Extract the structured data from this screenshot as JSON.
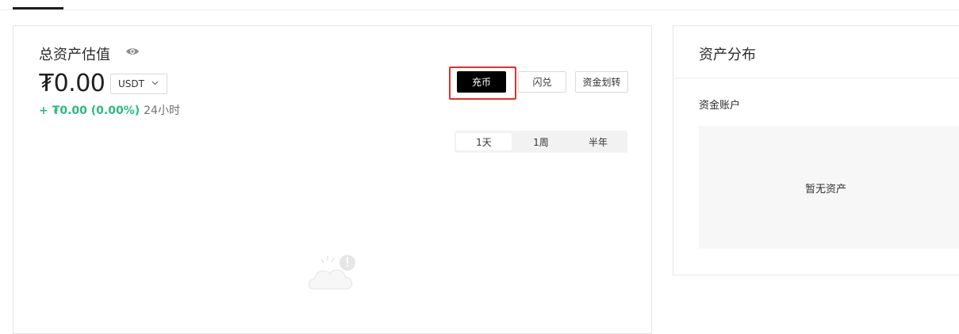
{
  "top_tabs": {
    "active_label": ""
  },
  "total_assets": {
    "title": "总资产估值",
    "balance": "₮0.00",
    "currency_select": {
      "selected": "USDT"
    },
    "change": {
      "value": "+ ₮0.00 (0.00%)",
      "period": "24小时"
    },
    "actions": {
      "deposit": "充币",
      "swap": "闪兑",
      "transfer": "资金划转"
    },
    "range_tabs": [
      {
        "label": "1天",
        "active": true
      },
      {
        "label": "1周",
        "active": false
      },
      {
        "label": "半年",
        "active": false
      }
    ],
    "icons": {
      "visibility": "eye-icon",
      "dropdown": "chevron-down-icon",
      "empty_state": "cloud-warning-icon"
    },
    "colors": {
      "positive": "#2fb881",
      "primary_button": "#000000",
      "highlight": "#e0302f"
    }
  },
  "asset_distribution": {
    "title": "资产分布",
    "account_label": "资金账户",
    "empty_text": "暂无资产"
  }
}
